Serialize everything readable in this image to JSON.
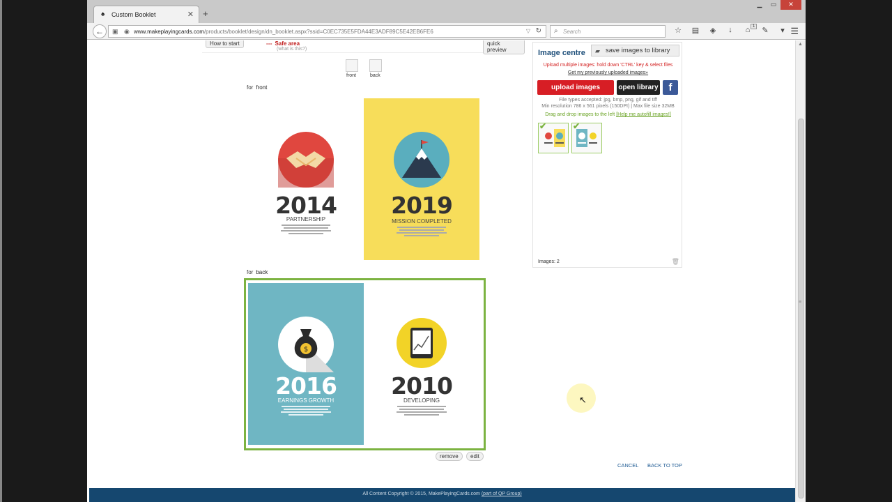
{
  "browser": {
    "tab_title": "Custom Booklet",
    "new_tab": "+",
    "url_domain": "www.makeplayingcards.com",
    "url_path": "/products/booklet/design/dn_booklet.aspx?ssid=C0EC735E5FDA44E3ADF89C5E42EB6FE6",
    "search_placeholder": "Search",
    "badge_count": "1"
  },
  "toolbar": {
    "how_to_start": "How to start",
    "safe_area": "Safe area",
    "what_is_this": "(what is this?)",
    "quick_preview": "quick preview"
  },
  "sides": {
    "front": "front",
    "back": "back"
  },
  "design": {
    "for_label": "for",
    "front_label": "front",
    "back_label": "back",
    "cards": [
      {
        "year": "2014",
        "caption": "PARTNERSHIP"
      },
      {
        "year": "2019",
        "caption": "MISSION COMPLETED"
      },
      {
        "year": "2016",
        "caption": "EARNINGS GROWTH"
      },
      {
        "year": "2010",
        "caption": "DEVELOPING"
      }
    ],
    "remove": "remove",
    "edit": "edit"
  },
  "colors": {
    "yellow": "#f7dd5a",
    "teal": "#6fb6c3",
    "red_circle": "#e0473f",
    "teal_circle": "#5aaebe",
    "yellow_circle": "#f2d327",
    "green_select": "#7cb341",
    "upload_red": "#d71e25",
    "library_black": "#222222",
    "footer_blue": "#15476f"
  },
  "panel": {
    "title": "Image centre",
    "save_library": "save images to library",
    "upload_hint": "Upload multiple images: hold down 'CTRL' key & select files",
    "prev_uploaded": "Get my previously uploaded images»",
    "upload_btn": "upload images",
    "library_btn": "open library",
    "fb": "f",
    "file_types": "File types accepted: jpg, bmp, png, gif and tiff",
    "min_res": "Min resolution 786 x 561 pixels (150DPI) | Max file size 32MB",
    "drag_drop": "Drag and drop images to the left",
    "autofill": "[Help me autofill images!]",
    "images_count": "Images: 2"
  },
  "links": {
    "cancel": "CANCEL",
    "back_to_top": "BACK TO TOP"
  },
  "footer": {
    "copyright": "All Content Copyright © 2015, MakePlayingCards.com",
    "group": "(part of QP Group)"
  }
}
